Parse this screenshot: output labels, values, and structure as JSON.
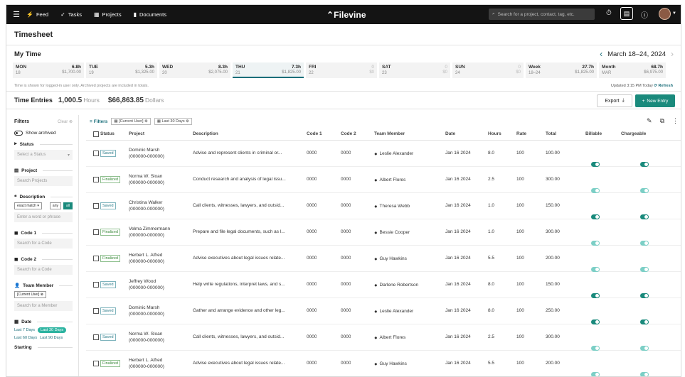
{
  "nav": {
    "items": [
      {
        "icon": "feed-icon",
        "glyph": "⚡",
        "label": "Feed"
      },
      {
        "icon": "tasks-icon",
        "glyph": "✓",
        "label": "Tasks"
      },
      {
        "icon": "projects-icon",
        "glyph": "▦",
        "label": "Projects"
      },
      {
        "icon": "documents-icon",
        "glyph": "▮",
        "label": "Documents"
      }
    ],
    "logo": "Filevine",
    "search_placeholder": "Search for a project, contact, tag, etc."
  },
  "page_title": "Timesheet",
  "mytime": {
    "title": "My Time",
    "range": "March 18–24, 2024",
    "days": [
      {
        "name": "MON",
        "date": "18",
        "hours": "6.8h",
        "money": "$1,700.00"
      },
      {
        "name": "TUE",
        "date": "19",
        "hours": "5.3h",
        "money": "$1,325.00"
      },
      {
        "name": "WED",
        "date": "20",
        "hours": "8.3h",
        "money": "$2,075.00"
      },
      {
        "name": "THU",
        "date": "21",
        "hours": "7.3h",
        "money": "$1,825.00"
      },
      {
        "name": "FRI",
        "date": "22",
        "hours": "0",
        "money": "$0"
      },
      {
        "name": "SAT",
        "date": "23",
        "hours": "0",
        "money": "$0"
      },
      {
        "name": "SUN",
        "date": "24",
        "hours": "0",
        "money": "$0"
      },
      {
        "name": "Week",
        "date": "18–24",
        "hours": "27.7h",
        "money": "$1,825.00"
      },
      {
        "name": "Month",
        "date": "MAR",
        "hours": "68.7h",
        "money": "$6,975.00"
      }
    ],
    "note": "Time is shown for logged-in user only. Archived projects are included in totals.",
    "updated": "Updated 3:15 PM Today",
    "refresh": "Refresh"
  },
  "time_entries": {
    "label": "Time Entries",
    "hours": "1,000.5",
    "hours_unit": "Hours",
    "dollars": "$66,863.85",
    "dollars_unit": "Dollars",
    "export": "Export",
    "new_entry": "New Entry"
  },
  "filters": {
    "title": "Filters",
    "clear": "Clear",
    "show_archived": "Show archived",
    "status": "Status",
    "status_placeholder": "Select a Status",
    "project": "Project",
    "project_placeholder": "Search Projects",
    "description": "Description",
    "match": "exact match",
    "any": "any",
    "all": "all",
    "desc_placeholder": "Enter a word or phrase",
    "code1": "Code 1",
    "code1_placeholder": "Search for a Code",
    "code2": "Code 2",
    "code2_placeholder": "Search for a Code",
    "team_member": "Team Member",
    "current_user": "[Current User]",
    "team_placeholder": "Search for a Member",
    "date": "Date",
    "dates": [
      "Last 7 Days",
      "Last 30 Days",
      "Last 60 Days",
      "Last 90 Days"
    ],
    "starting": "Starting",
    "clear2": "Clear"
  },
  "table_filters": {
    "label": "Filters",
    "tag1": "[Current User]",
    "tag2": "Last 30 Days"
  },
  "columns": [
    "Status",
    "Project",
    "Description",
    "Code 1",
    "Code 2",
    "Team Member",
    "Date",
    "Hours",
    "Rate",
    "Total",
    "Billable",
    "Chargeable"
  ],
  "rows": [
    {
      "status": "Saved",
      "project": "Dominic Marsh",
      "pid": "(000000-000000)",
      "desc": "Advise and represent clients in criminal or...",
      "code1": "0000",
      "code2": "0000",
      "member": "Leslie Alexander",
      "date": "Jan 16 2024",
      "hours": "8.0",
      "rate": "100",
      "total": "100.00"
    },
    {
      "status": "Finalized",
      "project": "Norma W. Sloan",
      "pid": "(000000-000000)",
      "desc": "Conduct research and analysis of legal issu...",
      "code1": "0000",
      "code2": "0000",
      "member": "Albert Flores",
      "date": "Jan 16 2024",
      "hours": "2.5",
      "rate": "100",
      "total": "300.00"
    },
    {
      "status": "Saved",
      "project": "Christina Walker",
      "pid": "(000000-000000)",
      "desc": "Call clients, witnesses, lawyers, and outsid...",
      "code1": "0000",
      "code2": "0000",
      "member": "Theresa Webb",
      "date": "Jan 16 2024",
      "hours": "1.0",
      "rate": "100",
      "total": "150.00"
    },
    {
      "status": "Finalized",
      "project": "Velma Zimmermann",
      "pid": "(000000-000000)",
      "desc": "Prepare and file legal documents, such as l...",
      "code1": "0000",
      "code2": "0000",
      "member": "Bessie Cooper",
      "date": "Jan 16 2024",
      "hours": "1.0",
      "rate": "100",
      "total": "300.00"
    },
    {
      "status": "Finalized",
      "project": "Herbert L. Alfred",
      "pid": "(000000-000000)",
      "desc": "Advise executives about legal issues relate...",
      "code1": "0000",
      "code2": "0000",
      "member": "Guy Hawkins",
      "date": "Jan 16 2024",
      "hours": "5.5",
      "rate": "100",
      "total": "200.00"
    },
    {
      "status": "Saved",
      "project": "Jeffrey Wood",
      "pid": "(000000-000000)",
      "desc": "Help write regulations, interpret laws, and s...",
      "code1": "0000",
      "code2": "0000",
      "member": "Darlene Robertson",
      "date": "Jan 16 2024",
      "hours": "8.0",
      "rate": "100",
      "total": "150.00"
    },
    {
      "status": "Saved",
      "project": "Dominic Marsh",
      "pid": "(000000-000000)",
      "desc": "Gather and arrange evidence and other leg...",
      "code1": "0000",
      "code2": "0000",
      "member": "Leslie Alexander",
      "date": "Jan 16 2024",
      "hours": "8.0",
      "rate": "100",
      "total": "250.00"
    },
    {
      "status": "Saved",
      "project": "Norma W. Sloan",
      "pid": "(000000-000000)",
      "desc": "Call clients, witnesses, lawyers, and outsid...",
      "code1": "0000",
      "code2": "0000",
      "member": "Albert Flores",
      "date": "Jan 16 2024",
      "hours": "2.5",
      "rate": "100",
      "total": "300.00"
    },
    {
      "status": "Finalized",
      "project": "Herbert L. Alfred",
      "pid": "(000000-000000)",
      "desc": "Advise executives about legal issues relate...",
      "code1": "0000",
      "code2": "0000",
      "member": "Guy Hawkins",
      "date": "Jan 16 2024",
      "hours": "5.5",
      "rate": "100",
      "total": "200.00"
    }
  ],
  "toggles": [
    {
      "billable": "on",
      "chargeable": "on"
    },
    {
      "billable": "light",
      "chargeable": "light"
    },
    {
      "billable": "on",
      "chargeable": "on"
    },
    {
      "billable": "light",
      "chargeable": "light"
    },
    {
      "billable": "light",
      "chargeable": "light"
    },
    {
      "billable": "on",
      "chargeable": "on"
    },
    {
      "billable": "on",
      "chargeable": "on"
    },
    {
      "billable": "light",
      "chargeable": "light"
    },
    {
      "billable": "light",
      "chargeable": "light"
    }
  ],
  "colors": {
    "accent": "#1a8a7c",
    "teal_dark": "#1a6e7a",
    "nav_bg": "#141414"
  }
}
